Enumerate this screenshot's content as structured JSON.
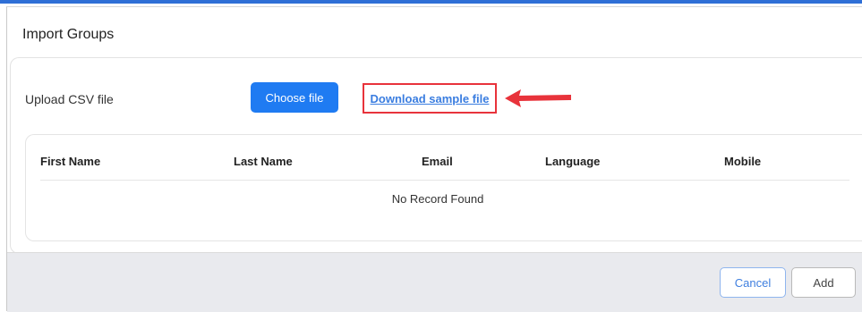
{
  "modal": {
    "title": "Import Groups"
  },
  "upload": {
    "label": "Upload CSV file",
    "choose_button": "Choose file",
    "download_link": "Download sample file"
  },
  "table": {
    "columns": [
      "First Name",
      "Last Name",
      "Email",
      "Language",
      "Mobile"
    ],
    "empty_message": "No Record Found"
  },
  "footer": {
    "cancel_label": "Cancel",
    "add_label": "Add"
  },
  "colors": {
    "primary": "#1f7bf2",
    "highlight_border": "#e8333b",
    "link": "#3a7de0",
    "footer_bg": "#e9eaee"
  },
  "icons": {
    "annotation_arrow": "left-arrow-icon"
  }
}
